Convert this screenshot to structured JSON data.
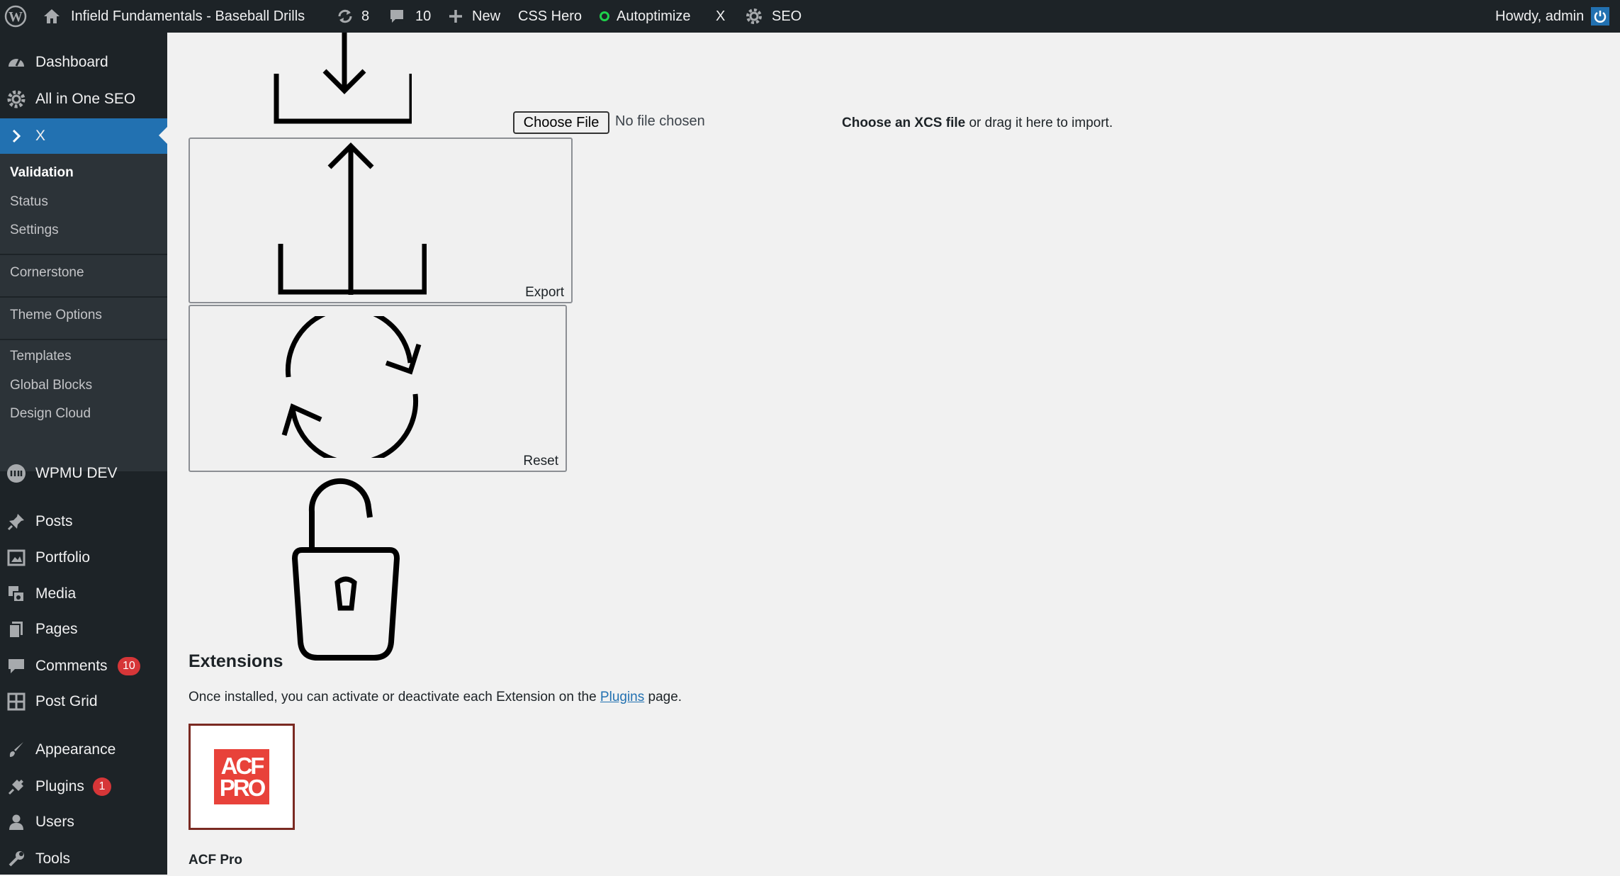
{
  "adminbar": {
    "site_name": "Infield Fundamentals - Baseball Drills",
    "updates_count": "8",
    "comments_count": "10",
    "new_label": "New",
    "css_hero_label": "CSS Hero",
    "autoptimize_label": "Autoptimize",
    "x_label": "X",
    "seo_label": "SEO",
    "howdy": "Howdy, admin"
  },
  "sidebar": {
    "top": [
      {
        "label": "Dashboard",
        "icon": "dashboard-icon"
      },
      {
        "label": "All in One SEO",
        "icon": "gear-icon"
      },
      {
        "label": "X",
        "icon": "chevron-right-icon"
      }
    ],
    "x_submenu": {
      "validation": "Validation",
      "status": "Status",
      "settings": "Settings",
      "cornerstone": "Cornerstone",
      "theme_options": "Theme Options",
      "templates": "Templates",
      "global_blocks": "Global Blocks",
      "design_cloud": "Design Cloud"
    },
    "wpmu_dev": "WPMU DEV",
    "posts": "Posts",
    "portfolio": "Portfolio",
    "media": "Media",
    "pages": "Pages",
    "comments": "Comments",
    "comments_badge": "10",
    "post_grid": "Post Grid",
    "appearance": "Appearance",
    "plugins": "Plugins",
    "plugins_badge": "1",
    "users": "Users",
    "tools": "Tools"
  },
  "main": {
    "choose_file_label": "Choose File",
    "no_file": "No file chosen",
    "import_hint_bold": "Choose an XCS file",
    "import_hint_rest": " or drag it here to import.",
    "export_label": "Export",
    "reset_label": "Reset",
    "extensions_heading": "Extensions",
    "extensions_desc_before": "Once installed, you can activate or deactivate each Extension on the ",
    "extensions_link": "Plugins",
    "extensions_desc_after": " page.",
    "acf_logo_text_1": "ACF",
    "acf_logo_text_2": "PRO",
    "acf_name": "ACF Pro"
  },
  "colors": {
    "adminbar_bg": "#1d2327",
    "sidebar_current": "#2271b1",
    "badge_red": "#d63638",
    "acf_red": "#e8423a",
    "autoptimize_green": "#1ed14b",
    "link_blue": "#2271b1"
  }
}
